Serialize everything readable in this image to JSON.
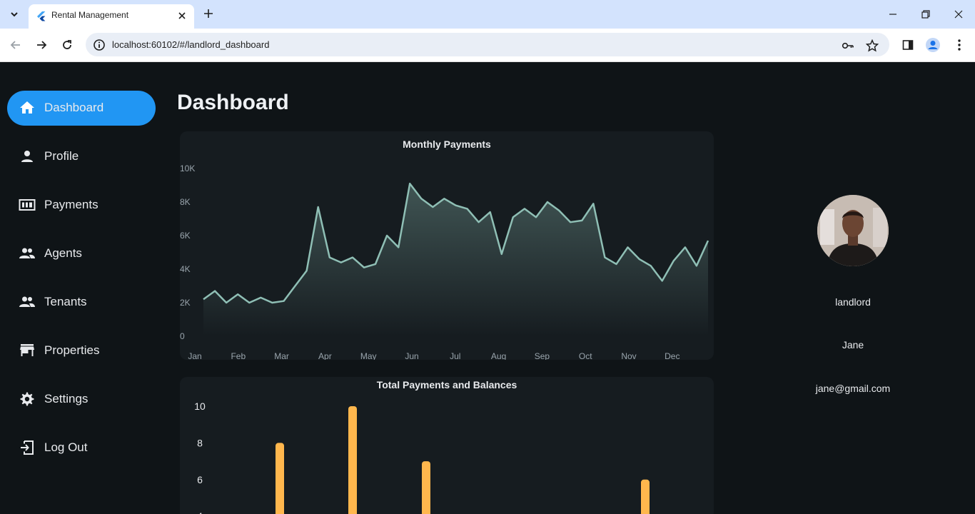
{
  "browser": {
    "tab_title": "Rental Management",
    "url": "localhost:60102/#/landlord_dashboard"
  },
  "sidebar": {
    "items": [
      {
        "label": "Dashboard",
        "icon": "home-icon",
        "active": true
      },
      {
        "label": "Profile",
        "icon": "person-icon",
        "active": false
      },
      {
        "label": "Payments",
        "icon": "payments-icon",
        "active": false
      },
      {
        "label": "Agents",
        "icon": "people-icon",
        "active": false
      },
      {
        "label": "Tenants",
        "icon": "people-icon",
        "active": false
      },
      {
        "label": "Properties",
        "icon": "store-icon",
        "active": false
      },
      {
        "label": "Settings",
        "icon": "gear-icon",
        "active": false
      },
      {
        "label": "Log Out",
        "icon": "logout-icon",
        "active": false
      }
    ]
  },
  "main": {
    "title": "Dashboard"
  },
  "profile": {
    "role": "landlord",
    "name": "Jane",
    "email": "jane@gmail.com"
  },
  "colors": {
    "accent": "#2196f3",
    "line": "#8fbfb5",
    "bar": "#ffb74d",
    "background": "#0f1417",
    "card": "#161c20"
  },
  "chart_data": [
    {
      "type": "area",
      "title": "Monthly Payments",
      "categories": [
        "Jan",
        "Feb",
        "Mar",
        "Apr",
        "May",
        "Jun",
        "Jul",
        "Aug",
        "Sep",
        "Oct",
        "Nov",
        "Dec"
      ],
      "y_ticks": [
        "0",
        "2K",
        "4K",
        "6K",
        "8K",
        "10K"
      ],
      "ylim": [
        0,
        10000
      ],
      "grid": false,
      "series": [
        {
          "values": [
            2200,
            2700,
            2000,
            2500,
            2000,
            2300,
            2000,
            2100,
            3000,
            3900,
            7700,
            4700,
            4400,
            4700,
            4100,
            4300,
            6000,
            5300,
            9100,
            8200,
            7700,
            8200,
            7800,
            7600,
            6800,
            7400,
            4900,
            7100,
            7600,
            7100,
            8000,
            7500,
            6800,
            6900,
            7900,
            4700,
            4300,
            5300,
            4600,
            4200,
            3300,
            4500,
            5300,
            4200,
            5700
          ]
        }
      ]
    },
    {
      "type": "bar",
      "title": "Total Payments and Balances",
      "y_ticks": [
        "4",
        "6",
        "8",
        "10"
      ],
      "ylim": [
        0,
        10
      ],
      "grid": false,
      "series": [
        {
          "values": [
            8,
            10,
            7,
            6
          ]
        }
      ]
    }
  ]
}
